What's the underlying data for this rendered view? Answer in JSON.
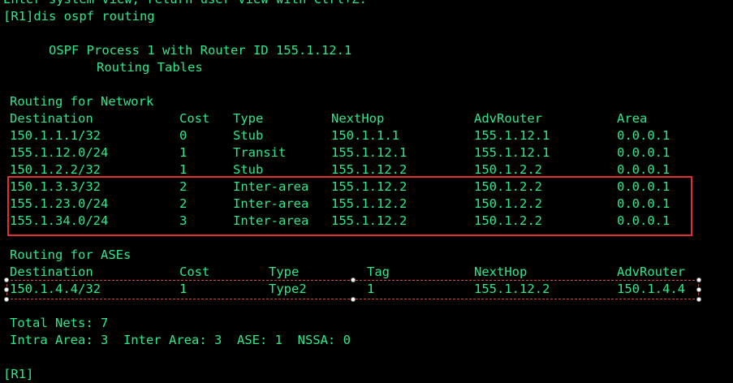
{
  "terminal": {
    "top_cut_line": "Enter system view, return user view with Ctrl+Z.",
    "command_line": "[R1]dis ospf routing",
    "process_line": "OSPF Process 1 with Router ID 155.1.12.1",
    "tables_title": "Routing Tables",
    "network_section": {
      "title": "Routing for Network",
      "headers": [
        "Destination",
        "Cost",
        "Type",
        "NextHop",
        "AdvRouter",
        "Area"
      ],
      "rows": [
        [
          "150.1.1.1/32",
          "0",
          "Stub",
          "150.1.1.1",
          "155.1.12.1",
          "0.0.0.1"
        ],
        [
          "155.1.12.0/24",
          "1",
          "Transit",
          "155.1.12.1",
          "155.1.12.1",
          "0.0.0.1"
        ],
        [
          "150.1.2.2/32",
          "1",
          "Stub",
          "155.1.12.2",
          "150.1.2.2",
          "0.0.0.1"
        ],
        [
          "150.1.3.3/32",
          "2",
          "Inter-area",
          "155.1.12.2",
          "150.1.2.2",
          "0.0.0.1"
        ],
        [
          "155.1.23.0/24",
          "2",
          "Inter-area",
          "155.1.12.2",
          "150.1.2.2",
          "0.0.0.1"
        ],
        [
          "155.1.34.0/24",
          "3",
          "Inter-area",
          "155.1.12.2",
          "150.1.2.2",
          "0.0.0.1"
        ]
      ]
    },
    "ase_section": {
      "title": "Routing for ASEs",
      "headers": [
        "Destination",
        "Cost",
        "Type",
        "Tag",
        "NextHop",
        "AdvRouter"
      ],
      "rows": [
        [
          "150.1.4.4/32",
          "1",
          "Type2",
          "1",
          "155.1.12.2",
          "150.1.4.4"
        ]
      ]
    },
    "total_line": "Total Nets: 7",
    "summary_line": "Intra Area: 3  Inter Area: 3  ASE: 1  NSSA: 0",
    "prompt_line": "[R1]"
  },
  "colors": {
    "background": "#000000",
    "text": "#2ee88a",
    "annotation_box": "#e03030",
    "selection_box": "#d04848"
  }
}
